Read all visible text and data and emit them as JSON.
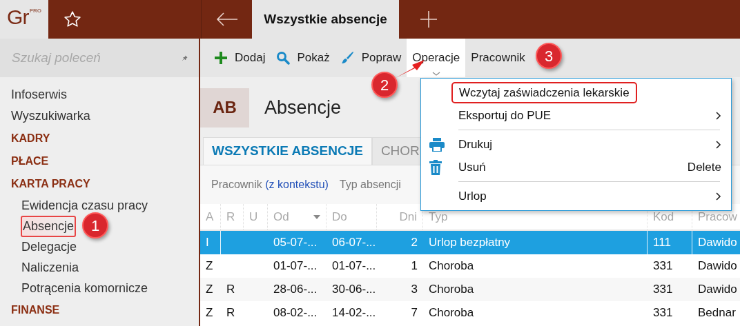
{
  "logo": {
    "letters": "Gr",
    "edition": "PRO"
  },
  "active_tab": {
    "label": "Wszystkie absencje"
  },
  "sidebar": {
    "search": {
      "placeholder": "Szukaj poleceń"
    },
    "items": [
      {
        "label": "Infoserwis",
        "kind": "link",
        "selected": false
      },
      {
        "label": "Wyszukiwarka",
        "kind": "link",
        "selected": false
      },
      {
        "label": "KADRY",
        "kind": "section",
        "selected": false
      },
      {
        "label": "PŁACE",
        "kind": "section",
        "selected": false
      },
      {
        "label": "KARTA PRACY",
        "kind": "section",
        "selected": false
      },
      {
        "label": "Ewidencja czasu pracy",
        "kind": "subitem",
        "selected": false
      },
      {
        "label": "Absencje",
        "kind": "subitem",
        "selected": true
      },
      {
        "label": "Delegacje",
        "kind": "subitem",
        "selected": false
      },
      {
        "label": "Naliczenia",
        "kind": "subitem",
        "selected": false
      },
      {
        "label": "Potrącenia komornicze",
        "kind": "subitem",
        "selected": false
      },
      {
        "label": "FINANSE",
        "kind": "section",
        "selected": false
      }
    ]
  },
  "toolbar": [
    {
      "label": "Dodaj",
      "kind": "add",
      "selected": false
    },
    {
      "label": "Pokaż",
      "kind": "show",
      "selected": false
    },
    {
      "label": "Popraw",
      "kind": "edit",
      "selected": false
    },
    {
      "label": "Operacje",
      "kind": "menu",
      "selected": true
    },
    {
      "label": "Pracownik",
      "kind": "menu",
      "selected": false
    }
  ],
  "page": {
    "badge": "AB",
    "title": "Absencje"
  },
  "tabs": [
    {
      "label": "WSZYSTKIE ABSENCJE",
      "selected": true
    },
    {
      "label": "CHOR",
      "selected": false
    }
  ],
  "filters": [
    {
      "label": "Pracownik",
      "value": "(z kontekstu)"
    },
    {
      "label": "Typ absencji"
    }
  ],
  "table": {
    "columns": [
      "A",
      "R",
      "U",
      "Od",
      "Do",
      "Dni",
      "Typ",
      "Kod",
      "Pracow"
    ],
    "rows": [
      {
        "selected": true,
        "cells": [
          "I",
          "",
          "",
          "05-07-...",
          "06-07-...",
          "2",
          "Urlop bezpłatny",
          "111",
          "Dawido"
        ]
      },
      {
        "selected": false,
        "cells": [
          "Z",
          "",
          "",
          "01-07-...",
          "01-07-...",
          "1",
          "Choroba",
          "331",
          "Dawido"
        ]
      },
      {
        "selected": false,
        "cells": [
          "Z",
          "R",
          "",
          "28-06-...",
          "30-06-...",
          "3",
          "Choroba",
          "331",
          "Dawido"
        ]
      },
      {
        "selected": false,
        "cells": [
          "Z",
          "R",
          "",
          "08-02-...",
          "14-02-...",
          "7",
          "Choroba",
          "331",
          "Bednar"
        ]
      }
    ]
  },
  "menu": [
    {
      "label": "Wczytaj zaświadczenia lekarskie",
      "kind": "plain",
      "submenu": false,
      "highlighted": true,
      "divider_before": false
    },
    {
      "label": "Eksportuj do PUE",
      "kind": "plain",
      "submenu": true,
      "highlighted": false,
      "divider_before": false
    },
    {
      "label": "Drukuj",
      "kind": "print",
      "submenu": true,
      "highlighted": false,
      "divider_before": true
    },
    {
      "label": "Usuń",
      "kind": "delete",
      "submenu": false,
      "shortcut": "Delete",
      "highlighted": false,
      "divider_before": false
    },
    {
      "label": "Urlop",
      "kind": "plain",
      "submenu": true,
      "highlighted": false,
      "divider_before": true
    }
  ],
  "callouts": [
    "1",
    "2",
    "3"
  ]
}
